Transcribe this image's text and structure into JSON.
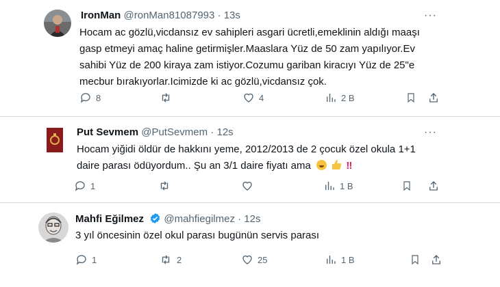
{
  "tweets": [
    {
      "name": "IronMan",
      "handle": "@ronMan81087993",
      "time": "13s",
      "lines": [
        "Hocam ac gözlü,vicdansız ev sahipleri asgari ücretli,emeklinin aldığı maaşı",
        "gasp etmeyi amaç haline getirmişler.Maaslara Yüz de 50 zam yapılıyor.Ev",
        "sahibi Yüz de 200 kiraya zam istiyor.Cozumu gariban kiracıyı  Yüz de 25\"e",
        "mecbur bırakıyorlar.Icimizde ki ac gözlü,vicdansız çok."
      ],
      "replies": "8",
      "retweets": "",
      "likes": "4",
      "views": "2 B"
    },
    {
      "name": "Put Sevmem",
      "handle": "@PutSevmem",
      "time": "12s",
      "lines": [
        "Hocam yiğidi öldür de hakkını yeme, 2012/2013 de 2 çocuk özel okula 1+1",
        "daire parası ödüyordum.. Şu an 3/1 daire fiyatı ama"
      ],
      "emojis": [
        "grinning-face",
        "thumbs-up",
        "double-exclamation"
      ],
      "replies": "1",
      "retweets": "",
      "likes": "",
      "views": "1 B"
    },
    {
      "name": "Mahfi Eğilmez",
      "handle": "@mahfiegilmez",
      "time": "12s",
      "verified": true,
      "lines": [
        "3 yıl öncesinin özel okul parası bugünün servis parası"
      ],
      "replies": "1",
      "retweets": "2",
      "likes": "25",
      "views": "1 B"
    }
  ],
  "separator": "·",
  "more_glyph": "···",
  "colors": {
    "text": "#0f1419",
    "muted": "#536471",
    "verified": "#1d9bf0",
    "divider": "#cfd9de"
  },
  "icons": [
    "reply-icon",
    "retweet-icon",
    "like-icon",
    "views-icon",
    "bookmark-icon",
    "share-icon",
    "more-icon",
    "verified-icon"
  ]
}
